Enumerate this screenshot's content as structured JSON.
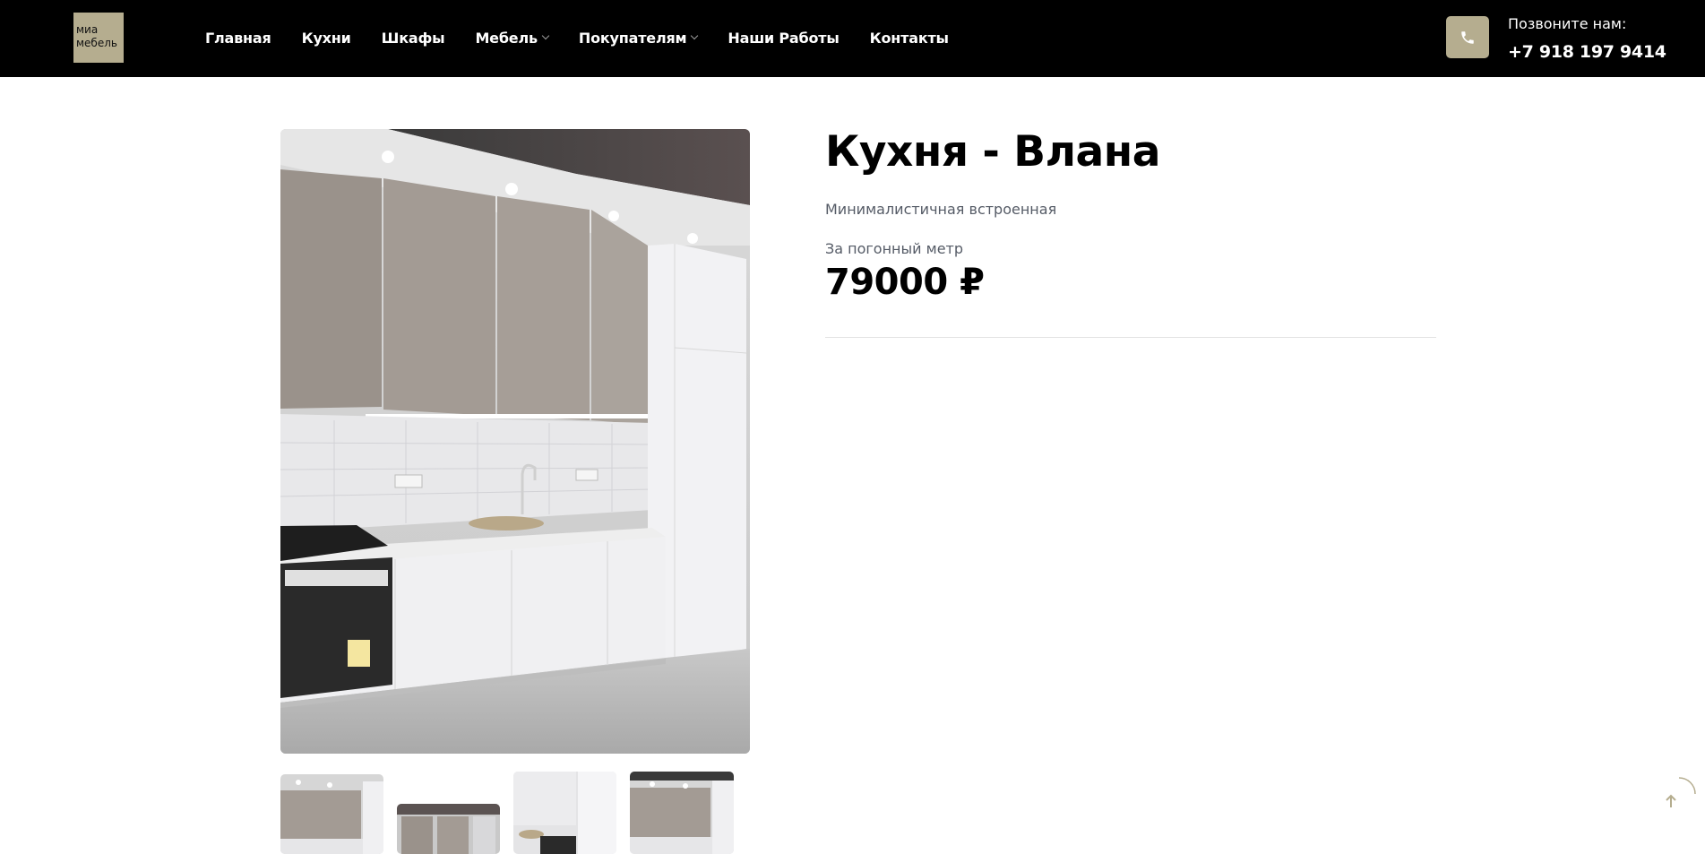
{
  "header": {
    "logo_line1": "миа",
    "logo_line2": "мебель",
    "nav": [
      {
        "label": "Главная",
        "dropdown": false
      },
      {
        "label": "Кухни",
        "dropdown": false
      },
      {
        "label": "Шкафы",
        "dropdown": false
      },
      {
        "label": "Мебель",
        "dropdown": true
      },
      {
        "label": "Покупателям",
        "dropdown": true
      },
      {
        "label": "Наши Работы",
        "dropdown": false
      },
      {
        "label": "Контакты",
        "dropdown": false
      }
    ],
    "call_label": "Позвоните нам:",
    "call_number": "+7 918 197 9414",
    "phone_icon": "phone-icon"
  },
  "product": {
    "title": "Кухня - Влана",
    "subtitle": "Минималистичная встроенная",
    "price_note": "За погонный метр",
    "price": "79000 ₽"
  },
  "gallery": {
    "thumbnail_count": 4
  },
  "colors": {
    "header_bg": "#000000",
    "accent": "#b5ad8f"
  }
}
